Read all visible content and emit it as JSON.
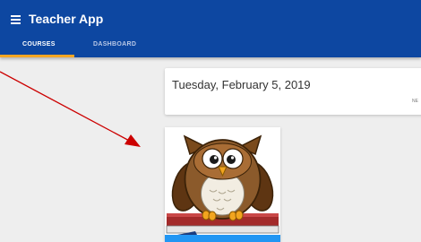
{
  "appbar": {
    "title": "Teacher App",
    "menu_icon": "hamburger-menu-icon",
    "background": "#0d47a1"
  },
  "tabs": [
    {
      "label": "COURSES",
      "selected": true
    },
    {
      "label": "DASHBOARD",
      "selected": false
    }
  ],
  "date_card": {
    "date": "Tuesday, February 5, 2019",
    "action_label": "NE"
  },
  "course_card": {
    "image_icon": "owl-on-book-icon",
    "strip_color": "#2196f3"
  },
  "annotation": {
    "arrow_color": "#cc0000"
  }
}
